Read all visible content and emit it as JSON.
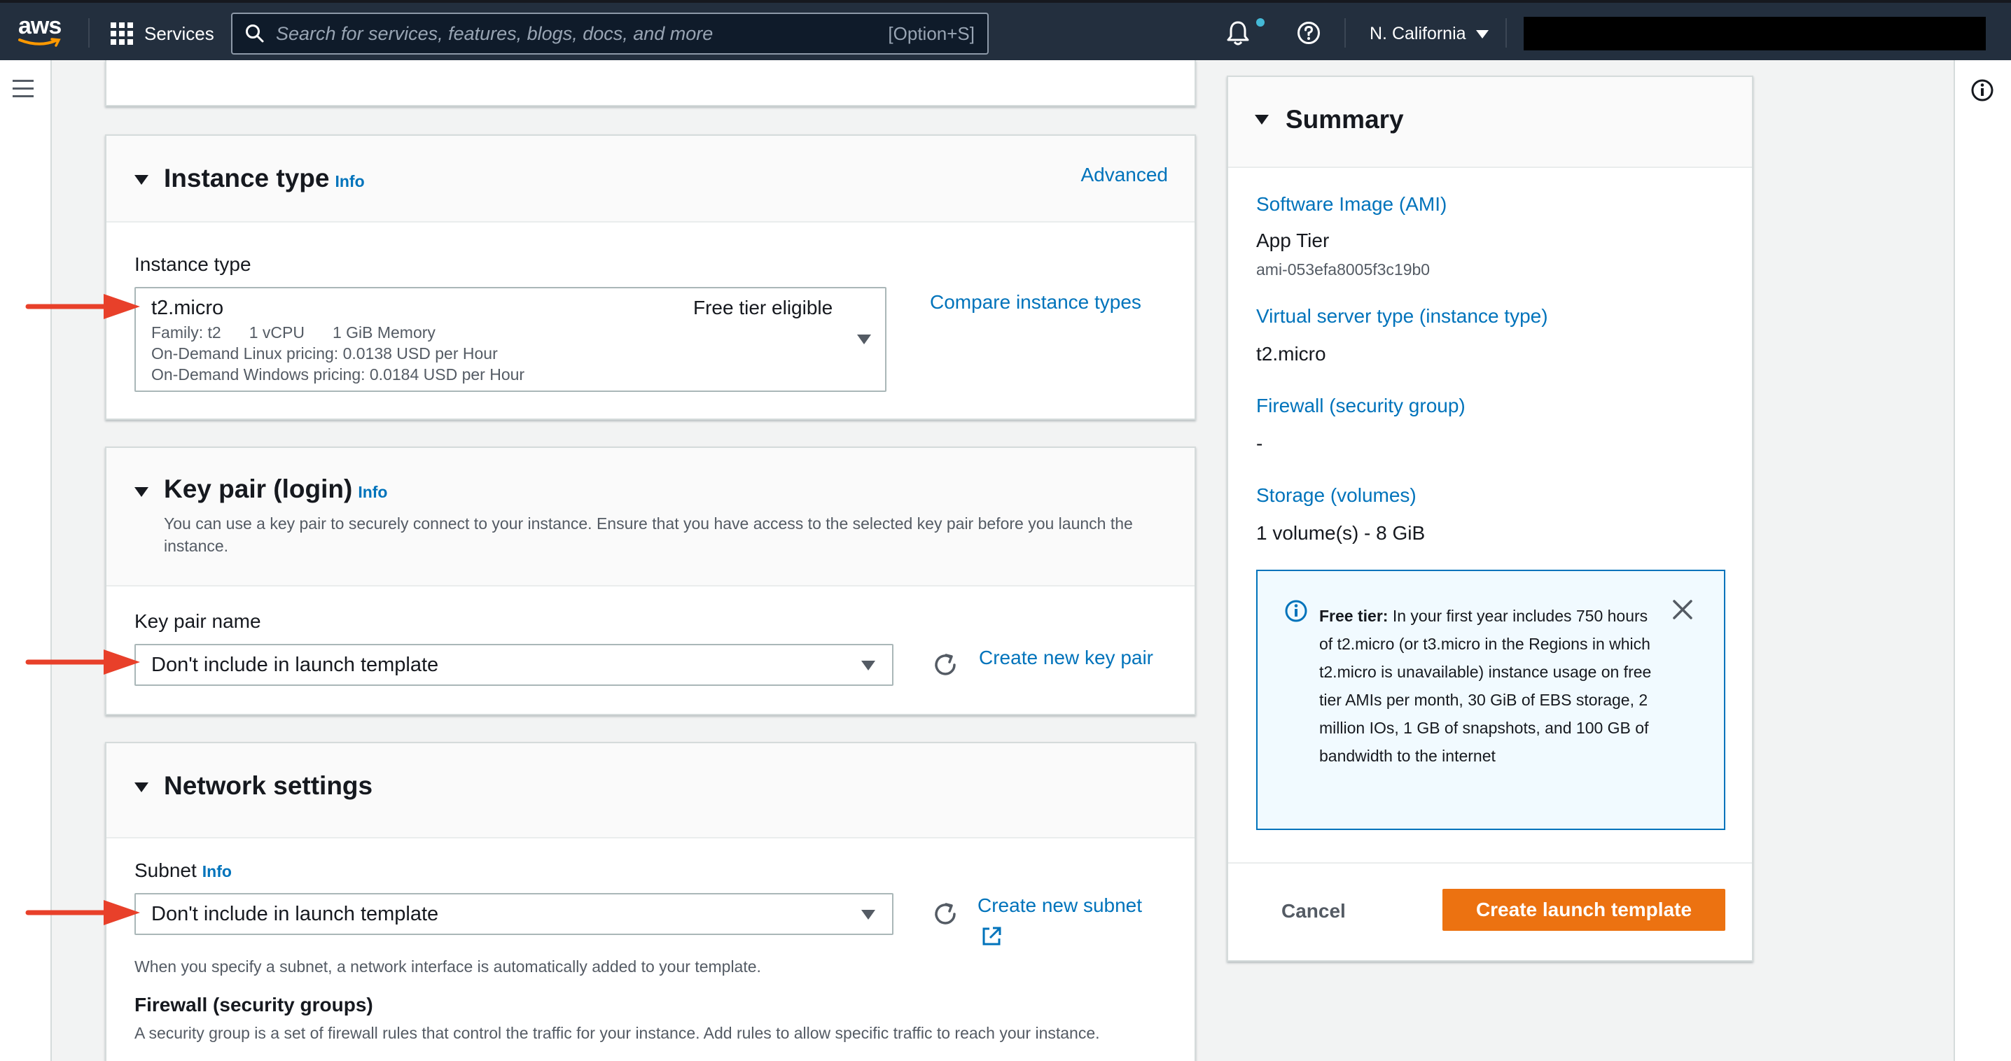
{
  "nav": {
    "logo_text": "aws",
    "services_label": "Services",
    "search_placeholder": "Search for services, features, blogs, docs, and more",
    "search_shortcut": "[Option+S]",
    "region": "N. California"
  },
  "instance_type": {
    "title": "Instance type",
    "info": "Info",
    "advanced": "Advanced",
    "field_label": "Instance type",
    "selected": "t2.micro",
    "free_tier": "Free tier eligible",
    "family": "Family: t2",
    "vcpu": "1 vCPU",
    "memory": "1 GiB Memory",
    "linux_pricing": "On-Demand Linux pricing: 0.0138 USD per Hour",
    "windows_pricing": "On-Demand Windows pricing: 0.0184 USD per Hour",
    "compare_link": "Compare instance types"
  },
  "key_pair": {
    "title": "Key pair (login)",
    "info": "Info",
    "description": "You can use a key pair to securely connect to your instance. Ensure that you have access to the selected key pair before you launch the instance.",
    "field_label": "Key pair name",
    "selected": "Don't include in launch template",
    "create_link": "Create new key pair"
  },
  "network": {
    "title": "Network settings",
    "subnet_label": "Subnet",
    "info": "Info",
    "selected": "Don't include in launch template",
    "create_link": "Create new subnet",
    "subnet_help": "When you specify a subnet, a network interface is automatically added to your template.",
    "firewall_title": "Firewall (security groups)",
    "firewall_desc": "A security group is a set of firewall rules that control the traffic for your instance. Add rules to allow specific traffic to reach your instance."
  },
  "summary": {
    "title": "Summary",
    "ami_label": "Software Image (AMI)",
    "ami_name": "App Tier",
    "ami_id": "ami-053efa8005f3c19b0",
    "server_type_label": "Virtual server type (instance type)",
    "server_type": "t2.micro",
    "firewall_label": "Firewall (security group)",
    "firewall_value": "-",
    "storage_label": "Storage (volumes)",
    "storage_value": "1 volume(s) - 8 GiB",
    "free_tier_bold": "Free tier:",
    "free_tier_text": " In your first year includes 750 hours of t2.micro (or t3.micro in the Regions in which t2.micro is unavailable) instance usage on free tier AMIs per month, 30 GiB of EBS storage, 2 million IOs, 1 GB of snapshots, and 100 GB of bandwidth to the internet",
    "cancel": "Cancel",
    "create_button": "Create launch template"
  },
  "colors": {
    "nav_bg": "#232f3e",
    "link": "#0073bb",
    "primary": "#ec7211",
    "annotation_arrow": "#e8402a"
  }
}
